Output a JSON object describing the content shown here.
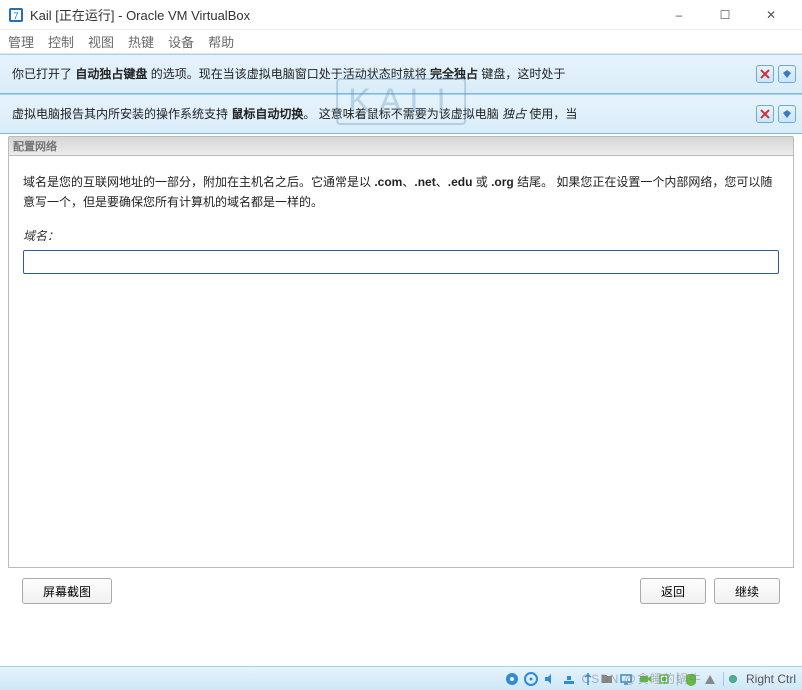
{
  "window": {
    "title": "Kail [正在运行] - Oracle VM VirtualBox",
    "controls": {
      "min": "–",
      "max": "☐",
      "close": "✕"
    }
  },
  "menu": {
    "manage": "管理",
    "control": "控制",
    "view": "视图",
    "hotkey": "热键",
    "device": "设备",
    "help": "帮助"
  },
  "notif1": {
    "t1": "你已打开了 ",
    "b1": "自动独占键盘",
    "t2": " 的选项。现在当该虚拟电脑窗口处于活动状态时就将 ",
    "b2": "完全独占",
    "t3": " 键盘，这时处于"
  },
  "notif2": {
    "t1": "虚拟电脑报告其内所安装的操作系统支持 ",
    "b1": "鼠标自动切换",
    "t2": "。 这意味着鼠标不需要为该虚拟电脑 ",
    "i1": "独占",
    "t3": " 使用，当"
  },
  "watermark": "KALI",
  "installer": {
    "section_title": "配置网络",
    "desc_p1": "域名是您的互联网地址的一部分，附加在主机名之后。它通常是以 ",
    "desc_b1": ".com",
    "desc_sep": "、",
    "desc_b2": ".net",
    "desc_b3": ".edu",
    "desc_or": " 或 ",
    "desc_b4": ".org",
    "desc_p2": " 结尾。 如果您正在设置一个内部网络，您可以随意写一个，但是要确保您所有计算机的域名都是一样的。",
    "field_label": "域名：",
    "domain_value": ""
  },
  "buttons": {
    "screenshot": "屏幕截图",
    "back": "返回",
    "continue": "继续"
  },
  "statusbar": {
    "host_key": "Right Ctrl",
    "watermark": "CSDN @贪睡的蜗牛"
  }
}
